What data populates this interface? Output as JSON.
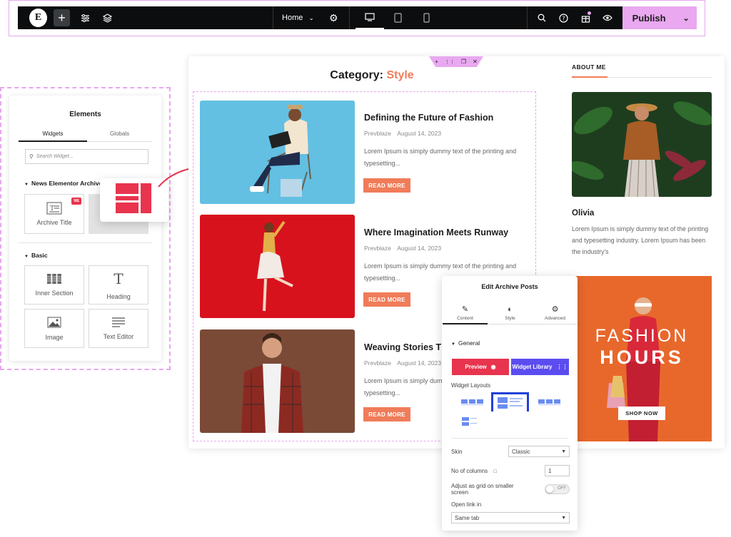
{
  "topbar": {
    "logo": "E",
    "page": "Home",
    "publish_label": "Publish"
  },
  "elements_panel": {
    "title": "Elements",
    "tabs": [
      "Widgets",
      "Globals"
    ],
    "search_placeholder": "Search Widget...",
    "section_news": "News Elementor Archive",
    "ne_badge": "NE",
    "archive_title_label": "Archive Title",
    "section_basic": "Basic",
    "basic_widgets": [
      "Inner Section",
      "Heading",
      "Image",
      "Text Editor"
    ]
  },
  "page": {
    "category_prefix": "Category:",
    "category_name": "Style",
    "accent": "#f07c59"
  },
  "posts": [
    {
      "title": "Defining the Future of Fashion",
      "author": "Prevblaze",
      "date": "August 14, 2023",
      "excerpt": "Lorem Ipsum is simply dummy text of the printing and typesetting...",
      "button": "READ MORE"
    },
    {
      "title": "Where Imagination Meets Runway",
      "author": "Prevblaze",
      "date": "August 14, 2023",
      "excerpt": "Lorem Ipsum is simply dummy text of the printing and typesetting...",
      "button": "READ MORE"
    },
    {
      "title": "Weaving Stories Thr",
      "author": "Prevblaze",
      "date": "August 14, 2023",
      "excerpt": "Lorem Ipsum is simply dummy text of the printing and typesetting...",
      "button": "READ MORE"
    }
  ],
  "sidebar": {
    "heading": "ABOUT ME",
    "name": "Olivia",
    "bio": "Lorem Ipsum is simply dummy text of the printing and typesetting industry. Lorem Ipsum has been the industry's",
    "banner_line1": "FASHION",
    "banner_line2": "HOURS",
    "banner_button": "SHOP NOW"
  },
  "edit_panel": {
    "title": "Edit Archive Posts",
    "tabs": [
      "Content",
      "Style",
      "Advanced"
    ],
    "section": "General",
    "preview_label": "Preview",
    "library_label": "Widget Library",
    "layouts_label": "Widget Layouts",
    "skin_label": "Skin",
    "skin_value": "Classic",
    "columns_label": "No of columns",
    "columns_value": "1",
    "grid_label": "Adjust as grid on smaller screen",
    "grid_toggle": "OFF",
    "link_label": "Open link in",
    "link_value": "Same tab"
  },
  "colors": {
    "pink_accent": "#e9a8f0",
    "preview_btn": "#e8344e",
    "library_btn": "#5b4cf0",
    "read_more": "#f07c59"
  }
}
